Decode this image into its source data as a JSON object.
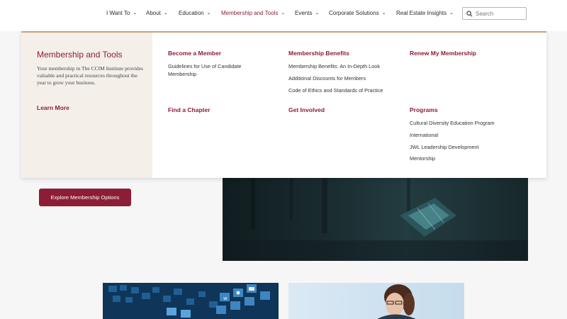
{
  "nav": {
    "items": [
      {
        "label": "I Want To"
      },
      {
        "label": "About"
      },
      {
        "label": "Education"
      },
      {
        "label": "Membership and Tools"
      },
      {
        "label": "Events"
      },
      {
        "label": "Corporate Solutions"
      },
      {
        "label": "Real Estate Insights"
      }
    ],
    "active_index": 3,
    "search": {
      "placeholder": "Search",
      "value": ""
    }
  },
  "mega_menu": {
    "side": {
      "title": "Membership and Tools",
      "description": "Your membership in The CCIM Institute provides valuable and practical resources throughout the year to grow your business.",
      "learn_more": "Learn More"
    },
    "columns": [
      {
        "heading": "Become a Member",
        "links": [
          "Guidelines for Use of Candidate Membership"
        ]
      },
      {
        "heading": "Membership Benefits",
        "links": [
          "Membership Benefits: An In-Depth Look",
          "Additional Discounts for Members",
          "Code of Ethics and Standards of Practice"
        ]
      },
      {
        "heading": "Renew My Membership",
        "links": []
      },
      {
        "heading": "Find a Chapter",
        "links": []
      },
      {
        "heading": "Get Involved",
        "links": []
      },
      {
        "heading": "Programs",
        "links": [
          "Cultural Diversity Education Program",
          "International",
          "JWL Leadership Development",
          "Mentorship"
        ]
      }
    ]
  },
  "page": {
    "cta_label": "Explore Membership Options"
  },
  "colors": {
    "brand": "#8d1d36",
    "menu_accent": "#c9a37a",
    "side_panel": "#f4efe8"
  }
}
